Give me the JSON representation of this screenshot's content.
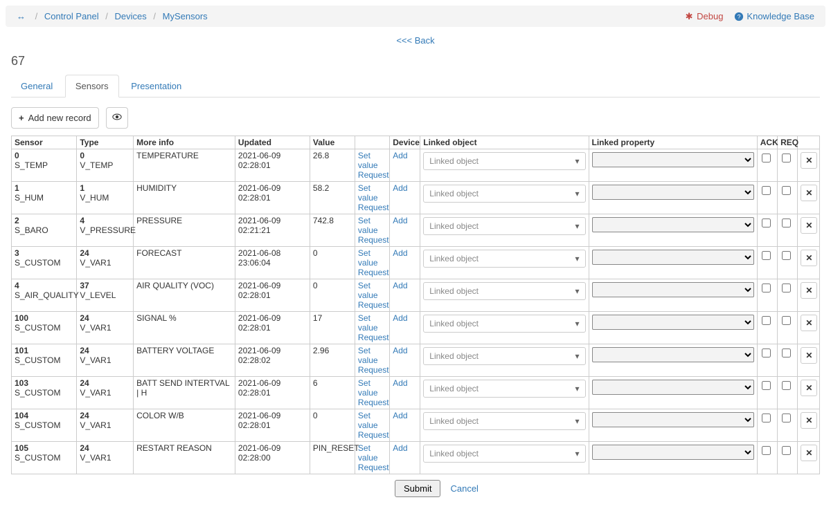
{
  "breadcrumb": {
    "root": "Control Panel",
    "mid": "Devices",
    "leaf": "MySensors"
  },
  "topbar": {
    "debug": "Debug",
    "kb": "Knowledge Base"
  },
  "back": "<<< Back",
  "page_id": "67",
  "tabs": {
    "general": "General",
    "sensors": "Sensors",
    "presentation": "Presentation"
  },
  "toolbar": {
    "add": "Add new record"
  },
  "table": {
    "headers": {
      "sensor": "Sensor",
      "type": "Type",
      "info": "More info",
      "updated": "Updated",
      "value": "Value",
      "actions": "",
      "device": "Device",
      "linked_obj": "Linked object",
      "linked_prop": "Linked property",
      "ack": "ACK",
      "req": "REQ",
      "del": ""
    },
    "placeholder": "Linked object",
    "actions": {
      "set": "Set value",
      "req": "Request",
      "add": "Add"
    },
    "rows": [
      {
        "s1": "0",
        "s2": "S_TEMP",
        "t1": "0",
        "t2": "V_TEMP",
        "info": "TEMPERATURE",
        "updated": "2021-06-09 02:28:01",
        "value": "26.8"
      },
      {
        "s1": "1",
        "s2": "S_HUM",
        "t1": "1",
        "t2": "V_HUM",
        "info": "HUMIDITY",
        "updated": "2021-06-09 02:28:01",
        "value": "58.2"
      },
      {
        "s1": "2",
        "s2": "S_BARO",
        "t1": "4",
        "t2": "V_PRESSURE",
        "info": "PRESSURE",
        "updated": "2021-06-09 02:21:21",
        "value": "742.8"
      },
      {
        "s1": "3",
        "s2": "S_CUSTOM",
        "t1": "24",
        "t2": "V_VAR1",
        "info": "FORECAST",
        "updated": "2021-06-08 23:06:04",
        "value": "0"
      },
      {
        "s1": "4",
        "s2": "S_AIR_QUALITY",
        "t1": "37",
        "t2": "V_LEVEL",
        "info": "AIR QUALITY (VOC)",
        "updated": "2021-06-09 02:28:01",
        "value": "0"
      },
      {
        "s1": "100",
        "s2": "S_CUSTOM",
        "t1": "24",
        "t2": "V_VAR1",
        "info": "SIGNAL %",
        "updated": "2021-06-09 02:28:01",
        "value": "17"
      },
      {
        "s1": "101",
        "s2": "S_CUSTOM",
        "t1": "24",
        "t2": "V_VAR1",
        "info": "BATTERY VOLTAGE",
        "updated": "2021-06-09 02:28:02",
        "value": "2.96"
      },
      {
        "s1": "103",
        "s2": "S_CUSTOM",
        "t1": "24",
        "t2": "V_VAR1",
        "info": "BATT SEND INTERTVAL | H",
        "updated": "2021-06-09 02:28:01",
        "value": "6"
      },
      {
        "s1": "104",
        "s2": "S_CUSTOM",
        "t1": "24",
        "t2": "V_VAR1",
        "info": "COLOR W/B",
        "updated": "2021-06-09 02:28:01",
        "value": "0"
      },
      {
        "s1": "105",
        "s2": "S_CUSTOM",
        "t1": "24",
        "t2": "V_VAR1",
        "info": "RESTART REASON",
        "updated": "2021-06-09 02:28:00",
        "value": "PIN_RESET"
      }
    ]
  },
  "footer": {
    "submit": "Submit",
    "cancel": "Cancel"
  }
}
